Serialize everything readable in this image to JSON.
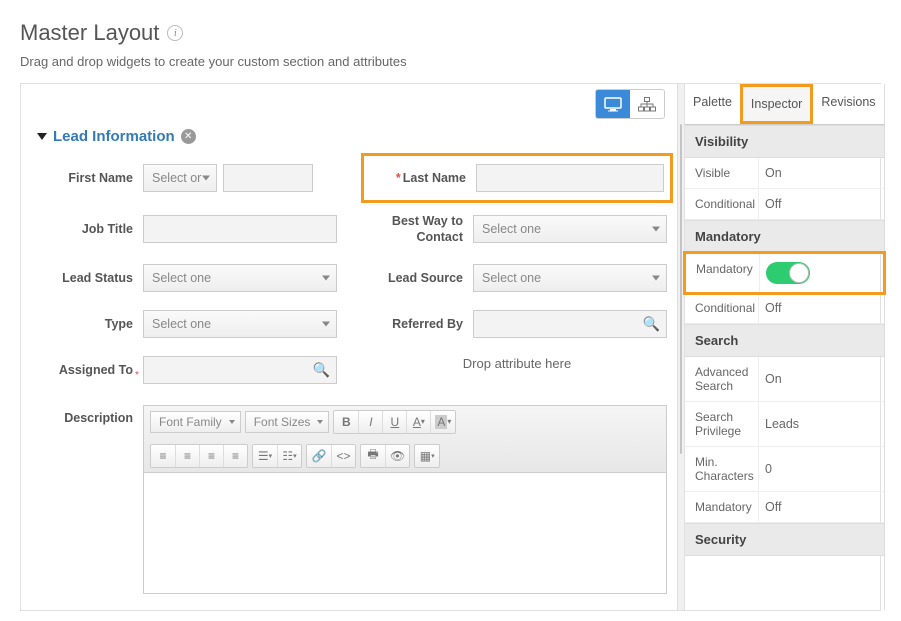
{
  "page": {
    "title": "Master Layout",
    "subtitle": "Drag and drop widgets to create your custom section and attributes"
  },
  "section": {
    "title": "Lead Information"
  },
  "fields": {
    "firstName": {
      "label": "First Name",
      "placeholder": "Select or"
    },
    "lastName": {
      "label": "Last Name"
    },
    "jobTitle": {
      "label": "Job Title"
    },
    "bestWayContact": {
      "label": "Best Way to Contact",
      "placeholder": "Select one"
    },
    "leadStatus": {
      "label": "Lead Status",
      "placeholder": "Select one"
    },
    "leadSource": {
      "label": "Lead Source",
      "placeholder": "Select one"
    },
    "type": {
      "label": "Type",
      "placeholder": "Select one"
    },
    "referredBy": {
      "label": "Referred By"
    },
    "assignedTo": {
      "label": "Assigned To"
    },
    "dropHint": "Drop attribute here",
    "description": {
      "label": "Description",
      "fontFamily": "Font Family",
      "fontSizes": "Font Sizes"
    }
  },
  "sidebar": {
    "tabs": {
      "palette": "Palette",
      "inspector": "Inspector",
      "revisions": "Revisions"
    },
    "groups": {
      "visibility": {
        "title": "Visibility",
        "visible": {
          "label": "Visible",
          "value": "On"
        },
        "conditional": {
          "label": "Conditional",
          "value": "Off"
        }
      },
      "mandatory": {
        "title": "Mandatory",
        "mandatory": {
          "label": "Mandatory"
        },
        "conditional": {
          "label": "Conditional",
          "value": "Off"
        }
      },
      "search": {
        "title": "Search",
        "advanced": {
          "label": "Advanced Search",
          "value": "On"
        },
        "privilege": {
          "label": "Search Privilege",
          "value": "Leads"
        },
        "minChars": {
          "label": "Min. Characters",
          "value": "0"
        },
        "mandatory": {
          "label": "Mandatory",
          "value": "Off"
        }
      },
      "security": {
        "title": "Security"
      }
    }
  }
}
